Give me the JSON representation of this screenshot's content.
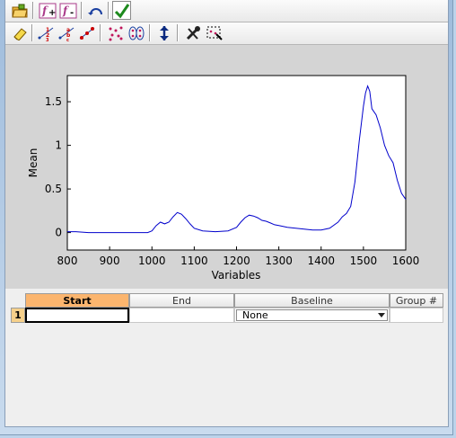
{
  "toolbar1": {
    "buttons": [
      {
        "name": "open-folder-icon",
        "glyph": "📂"
      },
      {
        "name": "add-function-icon",
        "glyph": "ƒ+"
      },
      {
        "name": "remove-function-icon",
        "glyph": "ƒ-"
      },
      {
        "name": "undo-icon",
        "glyph": "↶"
      },
      {
        "name": "apply-check-icon",
        "glyph": "✔"
      }
    ]
  },
  "toolbar2": {
    "buttons": [
      {
        "name": "eraser-icon",
        "glyph": "✎"
      },
      {
        "name": "number-points-icon",
        "glyph": "⅓"
      },
      {
        "name": "letter-points-icon",
        "glyph": "ᵃᵇ"
      },
      {
        "name": "connect-points-icon",
        "glyph": "⋰"
      },
      {
        "name": "scatter-points-icon",
        "glyph": "⁙"
      },
      {
        "name": "grouped-points-icon",
        "glyph": "⁘"
      },
      {
        "name": "vertical-resize-icon",
        "glyph": "↕"
      },
      {
        "name": "tools-icon",
        "glyph": "🛠"
      },
      {
        "name": "select-region-icon",
        "glyph": "⬚"
      }
    ]
  },
  "chart_data": {
    "type": "line",
    "xlabel": "Variables",
    "ylabel": "Mean",
    "xlim": [
      800,
      1600
    ],
    "ylim": [
      -0.2,
      1.8
    ],
    "xticks": [
      800,
      900,
      1000,
      1100,
      1200,
      1300,
      1400,
      1500,
      1600
    ],
    "yticks": [
      0,
      0.5,
      1,
      1.5
    ],
    "ytick_labels": [
      "0",
      "0.5",
      "1",
      "1.5"
    ],
    "color": "#0000cc",
    "series": [
      {
        "x": [
          800,
          820,
          850,
          900,
          950,
          990,
          1000,
          1010,
          1020,
          1030,
          1040,
          1050,
          1060,
          1070,
          1080,
          1090,
          1100,
          1120,
          1150,
          1180,
          1200,
          1210,
          1220,
          1230,
          1240,
          1250,
          1260,
          1270,
          1280,
          1290,
          1300,
          1320,
          1340,
          1360,
          1380,
          1400,
          1420,
          1440,
          1450,
          1460,
          1470,
          1480,
          1490,
          1500,
          1505,
          1510,
          1515,
          1520,
          1530,
          1540,
          1550,
          1560,
          1570,
          1580,
          1590,
          1600
        ],
        "y": [
          0.01,
          0.01,
          0.0,
          0.0,
          0.0,
          0.0,
          0.02,
          0.08,
          0.12,
          0.1,
          0.12,
          0.18,
          0.23,
          0.21,
          0.16,
          0.1,
          0.05,
          0.02,
          0.01,
          0.02,
          0.06,
          0.12,
          0.17,
          0.2,
          0.19,
          0.17,
          0.14,
          0.13,
          0.11,
          0.09,
          0.08,
          0.06,
          0.05,
          0.04,
          0.03,
          0.03,
          0.05,
          0.12,
          0.18,
          0.22,
          0.3,
          0.58,
          1.05,
          1.45,
          1.6,
          1.68,
          1.62,
          1.42,
          1.35,
          1.2,
          1.0,
          0.88,
          0.8,
          0.6,
          0.45,
          0.38
        ]
      }
    ]
  },
  "table": {
    "columns": [
      "Start",
      "End",
      "Baseline",
      "Group #"
    ],
    "rows": [
      {
        "index": "1",
        "start": "",
        "end": "",
        "baseline": "None",
        "group": ""
      }
    ]
  }
}
